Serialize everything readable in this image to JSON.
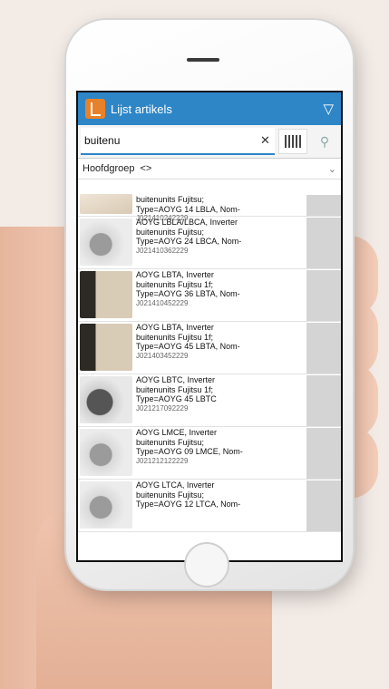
{
  "app": {
    "title": "Lijst artikels"
  },
  "search": {
    "value": "buitenu"
  },
  "group": {
    "label": "Hoofdgroep",
    "separator": "<>"
  },
  "articles": [
    {
      "lines": [
        "buitenunits Fujitsu;",
        "Type=AOYG 14 LBLA, Nom-"
      ],
      "code": "J021410242229"
    },
    {
      "lines": [
        "AOYG LBLA/LBCA, Inverter",
        "buitenunits Fujitsu;",
        "Type=AOYG 24 LBCA, Nom-"
      ],
      "code": "J021410362229"
    },
    {
      "lines": [
        "AOYG LBTA, Inverter",
        "buitenunits Fujitsu 1f;",
        "Type=AOYG 36 LBTA, Nom-"
      ],
      "code": "J021410452229"
    },
    {
      "lines": [
        "AOYG LBTA, Inverter",
        "buitenunits Fujitsu 1f;",
        "Type=AOYG 45 LBTA, Nom-"
      ],
      "code": "J021403452229"
    },
    {
      "lines": [
        "AOYG LBTC, Inverter",
        "buitenunits Fujitsu 1f;",
        "Type=AOYG 45 LBTC"
      ],
      "code": "J021217092229"
    },
    {
      "lines": [
        "AOYG LMCE, Inverter",
        "buitenunits Fujitsu;",
        "Type=AOYG 09 LMCE, Nom-"
      ],
      "code": "J021212122229"
    },
    {
      "lines": [
        "AOYG LTCA, Inverter",
        "buitenunits Fujitsu;",
        "Type=AOYG 12 LTCA, Nom-"
      ],
      "code": ""
    }
  ]
}
